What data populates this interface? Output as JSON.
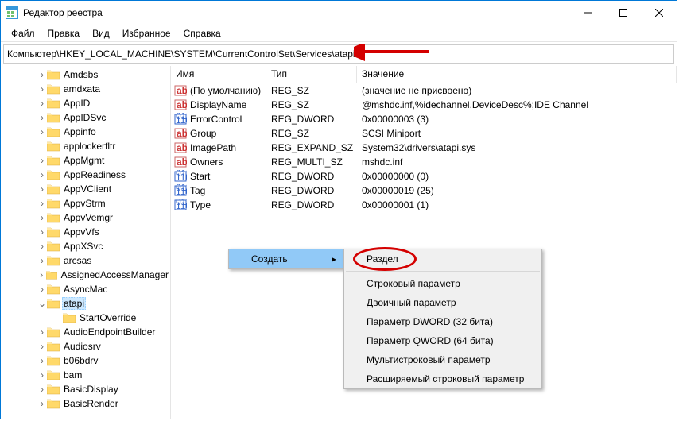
{
  "title": "Редактор реестра",
  "menu": {
    "file": "Файл",
    "edit": "Правка",
    "view": "Вид",
    "fav": "Избранное",
    "help": "Справка"
  },
  "address": "Компьютер\\HKEY_LOCAL_MACHINE\\SYSTEM\\CurrentControlSet\\Services\\atapi",
  "cols": {
    "name": "Имя",
    "type": "Тип",
    "value": "Значение"
  },
  "tree": [
    {
      "label": "Amdsbs",
      "exp": ">",
      "indent": 1
    },
    {
      "label": "amdxata",
      "exp": ">",
      "indent": 1
    },
    {
      "label": "AppID",
      "exp": ">",
      "indent": 1
    },
    {
      "label": "AppIDSvc",
      "exp": ">",
      "indent": 1
    },
    {
      "label": "Appinfo",
      "exp": ">",
      "indent": 1
    },
    {
      "label": "applockerfltr",
      "exp": "",
      "indent": 1
    },
    {
      "label": "AppMgmt",
      "exp": ">",
      "indent": 1
    },
    {
      "label": "AppReadiness",
      "exp": ">",
      "indent": 1
    },
    {
      "label": "AppVClient",
      "exp": ">",
      "indent": 1
    },
    {
      "label": "AppvStrm",
      "exp": ">",
      "indent": 1
    },
    {
      "label": "AppvVemgr",
      "exp": ">",
      "indent": 1
    },
    {
      "label": "AppvVfs",
      "exp": ">",
      "indent": 1
    },
    {
      "label": "AppXSvc",
      "exp": ">",
      "indent": 1
    },
    {
      "label": "arcsas",
      "exp": ">",
      "indent": 1
    },
    {
      "label": "AssignedAccessManager",
      "exp": ">",
      "indent": 1
    },
    {
      "label": "AsyncMac",
      "exp": ">",
      "indent": 1
    },
    {
      "label": "atapi",
      "exp": "v",
      "indent": 1,
      "selected": true
    },
    {
      "label": "StartOverride",
      "exp": "",
      "indent": 2
    },
    {
      "label": "AudioEndpointBuilder",
      "exp": ">",
      "indent": 1
    },
    {
      "label": "Audiosrv",
      "exp": ">",
      "indent": 1
    },
    {
      "label": "b06bdrv",
      "exp": ">",
      "indent": 1
    },
    {
      "label": "bam",
      "exp": ">",
      "indent": 1
    },
    {
      "label": "BasicDisplay",
      "exp": ">",
      "indent": 1
    },
    {
      "label": "BasicRender",
      "exp": ">",
      "indent": 1
    }
  ],
  "values": [
    {
      "icon": "ab",
      "name": "(По умолчанию)",
      "type": "REG_SZ",
      "value": "(значение не присвоено)"
    },
    {
      "icon": "ab",
      "name": "DisplayName",
      "type": "REG_SZ",
      "value": "@mshdc.inf,%idechannel.DeviceDesc%;IDE Channel"
    },
    {
      "icon": "bin",
      "name": "ErrorControl",
      "type": "REG_DWORD",
      "value": "0x00000003 (3)"
    },
    {
      "icon": "ab",
      "name": "Group",
      "type": "REG_SZ",
      "value": "SCSI Miniport"
    },
    {
      "icon": "ab",
      "name": "ImagePath",
      "type": "REG_EXPAND_SZ",
      "value": "System32\\drivers\\atapi.sys"
    },
    {
      "icon": "ab",
      "name": "Owners",
      "type": "REG_MULTI_SZ",
      "value": "mshdc.inf"
    },
    {
      "icon": "bin",
      "name": "Start",
      "type": "REG_DWORD",
      "value": "0x00000000 (0)"
    },
    {
      "icon": "bin",
      "name": "Tag",
      "type": "REG_DWORD",
      "value": "0x00000019 (25)"
    },
    {
      "icon": "bin",
      "name": "Type",
      "type": "REG_DWORD",
      "value": "0x00000001 (1)"
    }
  ],
  "ctx1": {
    "create": "Создать"
  },
  "ctx2": {
    "key": "Раздел",
    "string": "Строковый параметр",
    "binary": "Двоичный параметр",
    "dword": "Параметр DWORD (32 бита)",
    "qword": "Параметр QWORD (64 бита)",
    "multi": "Мультистроковый параметр",
    "expand": "Расширяемый строковый параметр"
  }
}
